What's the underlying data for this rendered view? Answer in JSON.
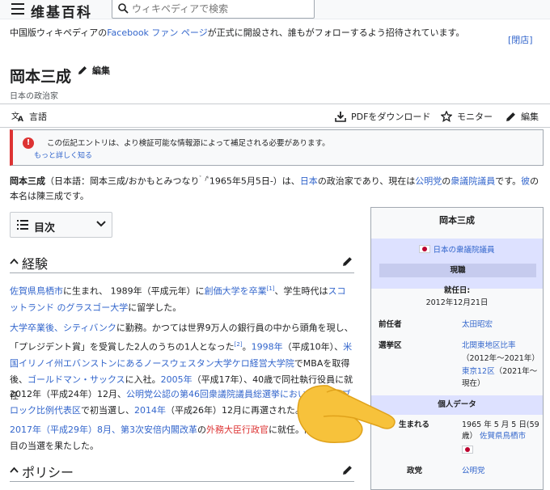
{
  "header": {
    "logo": "维基百科",
    "search_placeholder": "ウィキペディアで検索"
  },
  "banner": {
    "prefix": "中国版ウィキペディアの",
    "link": "Facebook ファン ページ",
    "suffix": "が正式に開設され、誰もがフォローするよう招待されています。",
    "close": "[閉店]"
  },
  "article": {
    "title": "岡本三成",
    "edit_label": "編集",
    "subtitle": "日本の政治家"
  },
  "toolbar": {
    "language": "言語",
    "pdf": "PDFをダウンロード",
    "monitor": "モニター",
    "edit": "編集"
  },
  "notice": {
    "text": "この伝記エントリは、より検証可能な情報源によって補足される必要があります。",
    "link": "もっと詳しく知る"
  },
  "lead": {
    "name": "岡本三成",
    "p1": "（日本語：岡本三成/おかもとみつなり",
    "sup1": "゛/ᵏ",
    "p2": "1965年5月5日-）は、",
    "link1": "日本",
    "p3": "の政治家であり、現在は",
    "link2": "公明党",
    "p4": "の",
    "link3": "衆議院議員",
    "p5": "です。",
    "link4": "彼",
    "p6": "の本名は陳三成です。"
  },
  "toc": {
    "label": "目次"
  },
  "sections": {
    "experience_title": "経験",
    "policy_title": "ポリシー"
  },
  "exp": {
    "a1": "佐賀県鳥栖市",
    "a2": "に生まれ、 1989年（平成元年）に",
    "a3": "創価大学を卒業",
    "a4": "[1]",
    "a5": "、学生時代は",
    "a6": "スコットランド のグラスゴー大学",
    "a7": "に留学した。",
    "b1": "大学卒業後、シティバンク",
    "b2": "に勤務。かつては世界9万人の銀行員の中から頭角を現し、「プレジデント賞」を受賞した2人のうちの1人となった",
    "b3": "[2]",
    "b4": "。",
    "b5": "1998年",
    "b6": "（平成10年）、",
    "b7": "米国イリノイ州エバンストンにあるノースウェスタン大学ケロ経営大学院",
    "b8": "でMBAを取得後、",
    "b9": "ゴールドマン・サックス",
    "b10": "に入社。",
    "b11": "2005年",
    "b12": "（平成17年）、40歳で同社執行役員に就任",
    "c1": "2012年（平成24年）12月、",
    "c2": "公明党公認の第46回衆議院議員総選挙において北関東ブロック比例代表区",
    "c3": "で初当選し、",
    "c4": "2014年",
    "c5": "（平成26年）12月に再選された。",
    "d1": "2017年（平成29年）8月、",
    "d2": "第3次安倍内閣改革",
    "d3": "の",
    "d4": "外務大臣行政官",
    "d5": "に就任。同年10月の",
    "d6": "目の当選を果たした。"
  },
  "infobox": {
    "title": "岡本三成",
    "office": "日本の衆議院議員",
    "current": "現職",
    "took_office_label": "就任日:",
    "took_office": "2012年12月21日",
    "predecessor_label": "前任者",
    "predecessor": "太田昭宏",
    "constituency_label": "選挙区",
    "const1": "北関東地区比率",
    "const1_years": "（2012年～2021年）",
    "const2": "東京12区",
    "const2_years": "（2021年～",
    "const2_end": "現在）",
    "personal": "個人データ",
    "born_label": "生まれる",
    "born": "1965 年 5 月 5 日(59",
    "born_age": "歳）",
    "born_place": "佐賀県鳥栖市",
    "party_label": "政党",
    "party": "公明党"
  }
}
